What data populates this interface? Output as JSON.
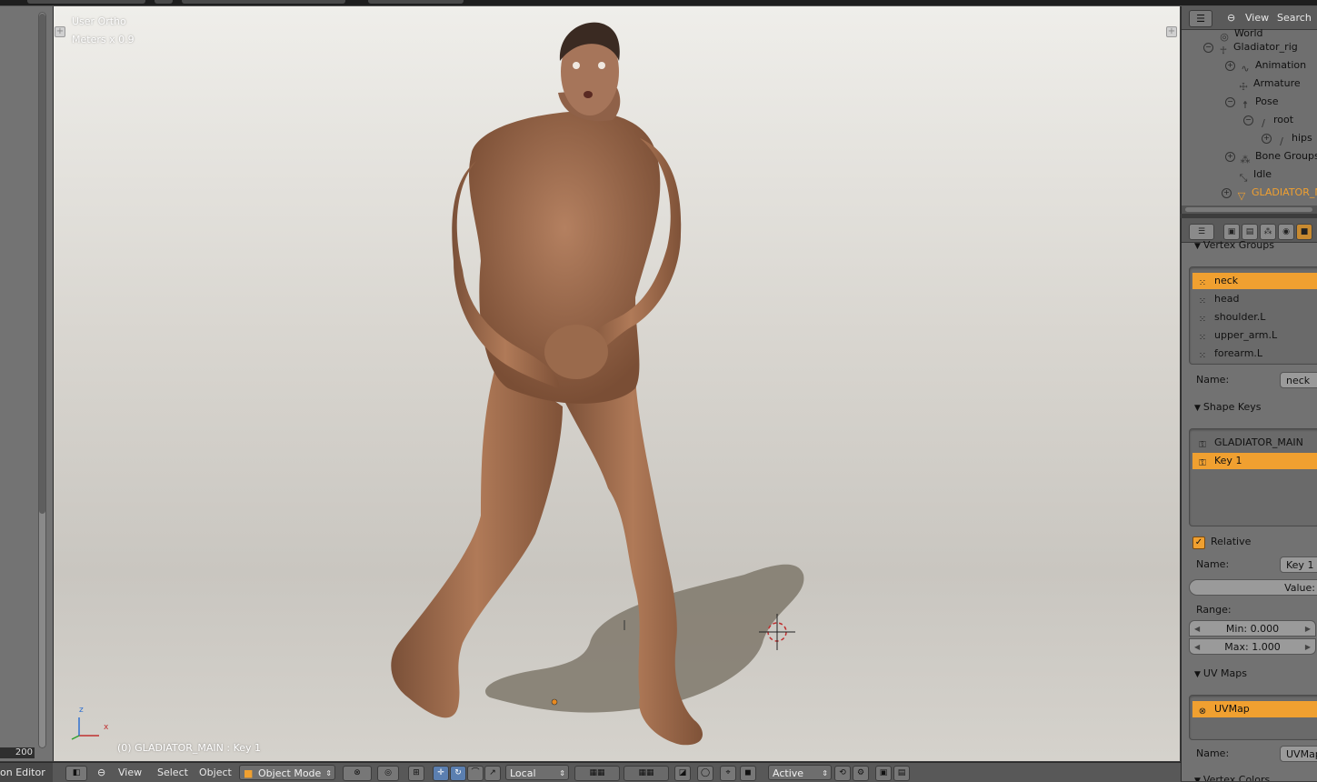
{
  "viewport": {
    "view_label": "User Ortho",
    "units_label": "Meters x 0.9",
    "object_info": "(0) GLADIATOR_MAIN : Key 1",
    "axis_x": "x",
    "axis_z": "z"
  },
  "timeline": {
    "frame_end": "200"
  },
  "outliner": {
    "menu_view": "View",
    "menu_search": "Search",
    "rows": [
      {
        "label": "World",
        "icon": "world-icon"
      },
      {
        "label": "Gladiator_rig",
        "icon": "armature-object-icon"
      },
      {
        "label": "Animation",
        "icon": "animation-icon"
      },
      {
        "label": "Armature",
        "icon": "armature-data-icon"
      },
      {
        "label": "Pose",
        "icon": "pose-icon"
      },
      {
        "label": "root",
        "icon": "bone-icon"
      },
      {
        "label": "hips",
        "icon": "bone-icon"
      },
      {
        "label": "Bone Groups",
        "icon": "bone-groups-icon"
      },
      {
        "label": "Idle",
        "icon": "action-icon"
      },
      {
        "label": "GLADIATOR_MAIN",
        "icon": "mesh-object-icon"
      }
    ]
  },
  "properties": {
    "vertex_groups": {
      "title": "Vertex Groups",
      "items": [
        "neck",
        "head",
        "shoulder.L",
        "upper_arm.L",
        "forearm.L"
      ],
      "name_label": "Name:",
      "name_value": "neck"
    },
    "shape_keys": {
      "title": "Shape Keys",
      "items": [
        "GLADIATOR_MAIN",
        "Key 1"
      ],
      "relative_label": "Relative",
      "name_label": "Name:",
      "name_value": "Key 1",
      "value_label": "Value:",
      "range_label": "Range:",
      "min_label": "Min: 0.000",
      "max_label": "Max: 1.000"
    },
    "uv_maps": {
      "title": "UV Maps",
      "items": [
        "UVMap"
      ],
      "name_label": "Name:",
      "name_value": "UVMap"
    },
    "vertex_colors": {
      "title": "Vertex Colors"
    }
  },
  "bottom_bar": {
    "editor_label": "on Editor",
    "menu_view": "View",
    "menu_select": "Select",
    "menu_object": "Object",
    "mode": "Object Mode",
    "orientation": "Local",
    "pivot": "Active"
  },
  "colors": {
    "selection": "#f0a030",
    "panel_bg": "#727272",
    "header_bg": "#585858"
  }
}
